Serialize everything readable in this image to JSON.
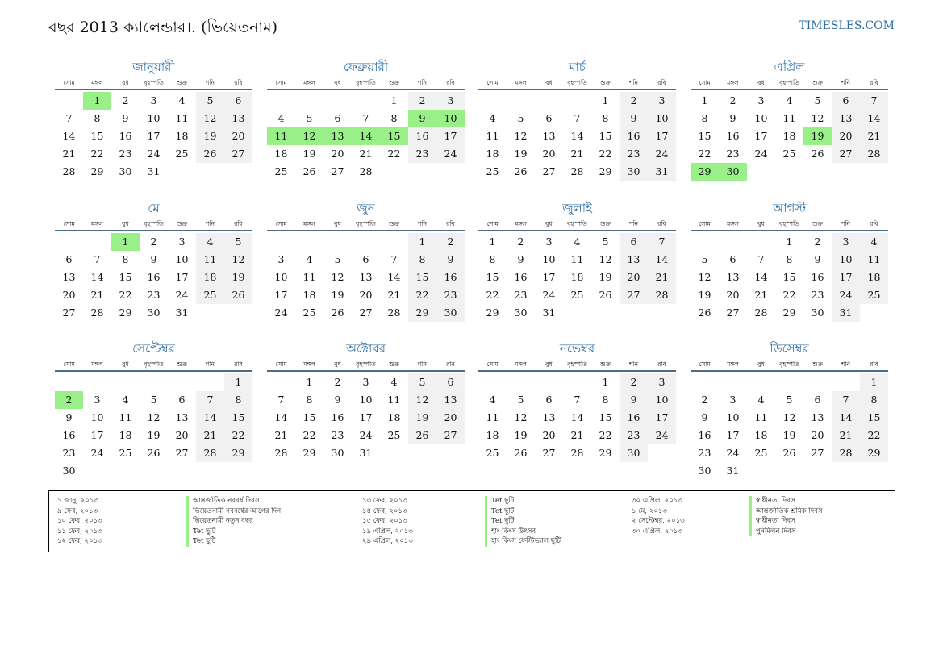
{
  "header": {
    "title": "বছর 2013 ক্যালেন্ডার।. (ভিয়েতনাম)",
    "site": "TIMESLES.COM"
  },
  "weekdays": [
    "সোম",
    "মঙ্গল",
    "বুধ",
    "বৃহস্পতি",
    "শুক্র",
    "শনি",
    "রবি"
  ],
  "months": [
    {
      "name": "জানুয়ারী",
      "offset": 1,
      "days": 31,
      "highlights": [
        1
      ]
    },
    {
      "name": "ফেব্রুয়ারী",
      "offset": 4,
      "days": 28,
      "highlights": [
        9,
        10,
        11,
        12,
        13,
        14,
        15
      ]
    },
    {
      "name": "মার্চ",
      "offset": 4,
      "days": 31,
      "highlights": []
    },
    {
      "name": "এপ্রিল",
      "offset": 0,
      "days": 30,
      "highlights": [
        19,
        29,
        30
      ]
    },
    {
      "name": "মে",
      "offset": 2,
      "days": 31,
      "highlights": [
        1
      ]
    },
    {
      "name": "জুন",
      "offset": 5,
      "days": 30,
      "highlights": []
    },
    {
      "name": "জুলাই",
      "offset": 0,
      "days": 31,
      "highlights": []
    },
    {
      "name": "আগস্ট",
      "offset": 3,
      "days": 31,
      "highlights": []
    },
    {
      "name": "সেপ্টেম্বর",
      "offset": 6,
      "days": 30,
      "highlights": [
        2
      ]
    },
    {
      "name": "অক্টোবর",
      "offset": 1,
      "days": 31,
      "highlights": []
    },
    {
      "name": "নভেম্বর",
      "offset": 4,
      "days": 30,
      "highlights": []
    },
    {
      "name": "ডিসেম্বর",
      "offset": 6,
      "days": 31,
      "highlights": []
    }
  ],
  "holidays": [
    [
      {
        "date": "১ জানু, ২০১৩",
        "name": "আন্তর্জাতিক নববর্ষ দিবস"
      },
      {
        "date": "৯ ফেব, ২০১৩",
        "name": "ভিয়েতনামী নববর্ষের আগের দিন"
      },
      {
        "date": "১০ ফেব, ২০১৩",
        "name": "ভিয়েতনামী নতুন বছর"
      },
      {
        "date": "১১ ফেব, ২০১৩",
        "name": "Tet ছুটি"
      },
      {
        "date": "১২ ফেব, ২০১৩",
        "name": "Tet ছুটি"
      }
    ],
    [
      {
        "date": "১৩ ফেব, ২০১৩",
        "name": "Tet ছুটি"
      },
      {
        "date": "১৪ ফেব, ২০১৩",
        "name": "Tet ছুটি"
      },
      {
        "date": "১৫ ফেব, ২০১৩",
        "name": "Tet ছুটি"
      },
      {
        "date": "১৯ এপ্রিল, ২০১৩",
        "name": "হাং কিংস উৎসব"
      },
      {
        "date": "২৯ এপ্রিল, ২০১৩",
        "name": "হাং কিংস ফেস্টিভ্যাল ছুটি"
      }
    ],
    [
      {
        "date": "৩০ এপ্রিল, ২০১৩",
        "name": "স্বাধীনতা দিবস"
      },
      {
        "date": "১ মে, ২০১৩",
        "name": "আন্তর্জাতিক শ্রমিক দিবস"
      },
      {
        "date": "২ সেপ্টেম্বর, ২০১৩",
        "name": "স্বাধীনতা দিবস"
      },
      {
        "date": "৩০ এপ্রিল, ২০১৩",
        "name": "পুনর্মিলন দিবস"
      }
    ]
  ]
}
